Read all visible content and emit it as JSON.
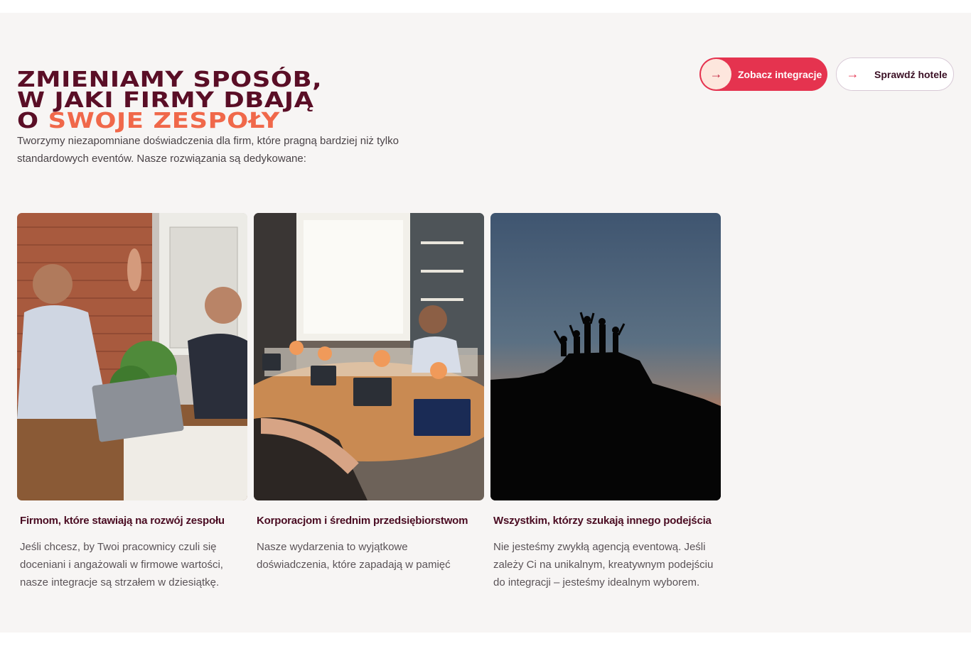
{
  "headline": {
    "line1": "ZMIENIAMY SPOSÓB,",
    "line2": "W JAKI FIRMY DBAJĄ",
    "line3_prefix": "O",
    "line3_accent": "SWOJE ZESPOŁY"
  },
  "lead": "Tworzymy niezapomniane doświadczenia dla firm, które pragną bardziej niż tylko standardowych eventów. Nasze rozwiązania są dedykowane:",
  "buttons": {
    "primary": {
      "label": "Zobacz integracje",
      "icon": "arrow-right-icon"
    },
    "secondary": {
      "label": "Sprawdź hotele",
      "icon": "arrow-right-icon"
    }
  },
  "cards": [
    {
      "title": "Firmom, które stawiają na rozwój zespołu",
      "text": "Jeśli chcesz, by Twoi pracownicy czuli się doceniani i angażowali w firmowe wartości, nasze integracje są strzałem w dziesiątkę.",
      "image": "office-high-five-photo"
    },
    {
      "title": "Korporacjom i średnim przedsiębiorstwom",
      "text": "Nasze wydarzenia to wyjątkowe doświadczenia, które zapadają w pamięć",
      "image": "conference-room-laptops-photo"
    },
    {
      "title": "Wszystkim, którzy szukają innego podejścia",
      "text": "Nie jesteśmy zwykłą agencją eventową. Jeśli zależy Ci na unikalnym, kreatywnym podejściu do integracji – jesteśmy idealnym wyborem.",
      "image": "mountain-silhouette-sunset-photo"
    }
  ],
  "colors": {
    "brand_dark": "#5a0e26",
    "accent_orange": "#f0684a",
    "button_red": "#e5334f",
    "section_bg": "#f7f5f4"
  }
}
